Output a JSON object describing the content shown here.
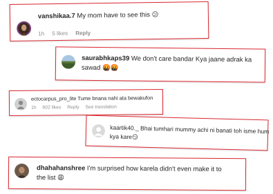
{
  "comments": [
    {
      "username": "vanshikaa.7",
      "text": "My mom have to see this",
      "emoji": "😕",
      "time": "1h",
      "likes": "5 likes",
      "reply": "Reply"
    },
    {
      "username": "saurabhkaps39",
      "text_line1": "We don't care bandar Kya jaane adrak ka",
      "text_line2": "sawad",
      "emoji": "🤬🤬"
    },
    {
      "username": "ectocarpus_pro_lite",
      "text": "Tume bnana nahi ata bewakufon",
      "time": "1h",
      "likes": "602 likes",
      "reply": "Reply",
      "see_translation": "See translation"
    },
    {
      "username": "kaartik40._",
      "text_line1": "Bhai tumhari mummy achi ni banati toh isme hum",
      "text_line2": "kya kare",
      "emoji": "😏"
    },
    {
      "username": "dhahahanshree",
      "text_line1": "I'm surprised how karela didn't even make it to",
      "text_line2": "the list",
      "emoji": "😩"
    }
  ],
  "colors": {
    "card_border": "#d9262e",
    "text": "#262626",
    "meta": "#8e8e8e"
  }
}
